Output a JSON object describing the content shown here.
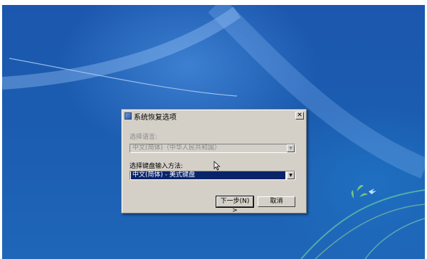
{
  "dialog": {
    "title": "系统恢复选项",
    "language_label": "选择语言:",
    "language_value": "中文(简体)（中华人民共和国）",
    "keyboard_label": "选择键盘输入方法:",
    "keyboard_value": "中文(简体) - 美式键盘",
    "next_button": "下一步(N) >",
    "cancel_button": "取消",
    "close_glyph": "✕"
  },
  "icons": {
    "dropdown": "▼",
    "window": "system-recovery-icon"
  }
}
